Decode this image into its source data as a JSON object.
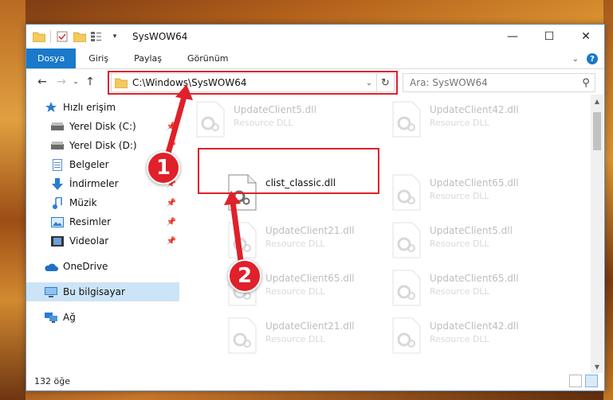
{
  "window": {
    "title": "SysWOW64"
  },
  "ribbon": {
    "tabs": [
      "Dosya",
      "Giriş",
      "Paylaş",
      "Görünüm"
    ]
  },
  "address": {
    "path": "C:\\Windows\\SysWOW64"
  },
  "search": {
    "placeholder": "Ara: SysWOW64"
  },
  "sidebar": {
    "items": [
      {
        "label": "Hızlı erişim",
        "icon": "star-icon"
      },
      {
        "label": "Yerel Disk (C:)",
        "icon": "drive-icon"
      },
      {
        "label": "Yerel Disk (D:)",
        "icon": "drive-icon"
      },
      {
        "label": "Belgeler",
        "icon": "documents-icon"
      },
      {
        "label": "İndirmeler",
        "icon": "download-icon"
      },
      {
        "label": "Müzik",
        "icon": "music-icon"
      },
      {
        "label": "Resimler",
        "icon": "pictures-icon"
      },
      {
        "label": "Videolar",
        "icon": "videos-icon"
      },
      {
        "label": "OneDrive",
        "icon": "cloud-icon"
      },
      {
        "label": "Bu bilgisayar",
        "icon": "computer-icon"
      },
      {
        "label": "Ağ",
        "icon": "network-icon"
      }
    ]
  },
  "files": {
    "main": {
      "name": "clist_classic.dll"
    },
    "faded": [
      {
        "name": "UpdateClient5.dll",
        "type": "Resource DLL"
      },
      {
        "name": "UpdateClient42.dll",
        "type": "Resource DLL"
      },
      {
        "name": "UpdateClient65.dll",
        "type": "Resource DLL"
      },
      {
        "name": "UpdateClient21.dll",
        "type": "Resource DLL"
      },
      {
        "name": "UpdateClient5.dll",
        "type": "Resource DLL"
      },
      {
        "name": "UpdateClient65.dll",
        "type": "Resource DLL"
      },
      {
        "name": "UpdateClient65.dll",
        "type": "Resource DLL"
      },
      {
        "name": "UpdateClient21.dll",
        "type": "Resource DLL"
      },
      {
        "name": "UpdateClient42.dll",
        "type": "Resource DLL"
      }
    ]
  },
  "status": {
    "count": "132 öğe"
  },
  "annotations": {
    "badge1": "1",
    "badge2": "2"
  },
  "colors": {
    "accent": "#1979ca",
    "highlight": "#e0202a",
    "selected": "#cce4f7"
  }
}
